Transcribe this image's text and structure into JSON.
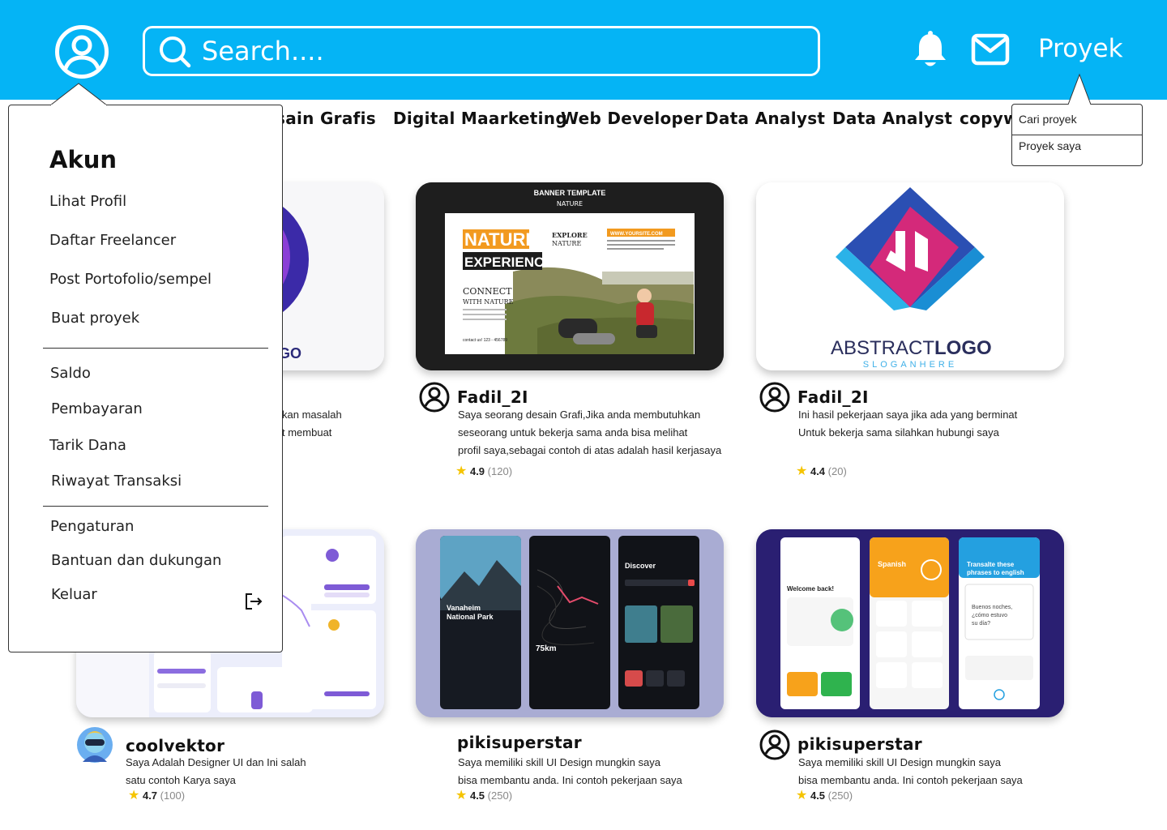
{
  "header": {
    "search_placeholder": "Search....",
    "proyek_label": "Proyek",
    "colors": {
      "header_bg": "#05b4f5",
      "header_text": "#ffffff"
    }
  },
  "categories": [
    "sain Grafis",
    "Digital Maarketing",
    "Web Developer",
    "Data Analyst",
    "Data Analyst",
    "copywr"
  ],
  "account_menu": {
    "title": "Akun",
    "group1": [
      "Lihat Profil",
      "Daftar Freelancer",
      "Post Portofolio/sempel",
      "Buat proyek"
    ],
    "group2": [
      "Saldo",
      "Pembayaran",
      "Tarik Dana",
      "Riwayat Transaksi"
    ],
    "group3": [
      "Pengaturan",
      "Bantuan  dan dukungan",
      "Keluar"
    ]
  },
  "proyek_menu": [
    "Cari proyek",
    "Proyek saya"
  ],
  "cards": [
    {
      "image": "logo design (partially hidden)",
      "image_text": "GO",
      "desc_visible": [
        "kan masalah",
        "t membuat"
      ]
    },
    {
      "image": "nature banner template",
      "image_texts": {
        "top_title": "BANNER TEMPLATE",
        "top_sub": "NATURE",
        "big1": "NATURE",
        "big2": "EXPERIENCE",
        "connect1": "CONNECT",
        "connect2": "WITH NATURE",
        "explore1": "EXPLORE",
        "explore2": "NATURE",
        "web": "WWW.YOURSITE.COM",
        "contact": "contact us! 123 - 456789"
      },
      "user": "Fadil_2I",
      "desc": [
        "Saya seorang desain Grafi,Jika anda membutuhkan",
        "seseorang untuk bekerja sama anda bisa melihat",
        "profil saya,sebagai contoh di atas adalah hasil kerjasaya"
      ],
      "rating": "4.9",
      "reviews": "(120)"
    },
    {
      "image": "abstract logo",
      "image_texts": {
        "logo1": "ABSTRACT",
        "logo2": "LOGO",
        "slogan": "SLOGANHERE"
      },
      "user": "Fadil_2I",
      "desc": [
        "Ini hasil pekerjaan saya jika ada yang  berminat",
        "Untuk bekerja sama silahkan hubungi saya"
      ],
      "rating": "4.4",
      "reviews": "(20)"
    },
    {
      "image": "dashboard ui",
      "user": "coolvektor",
      "desc": [
        "Saya Adalah Designer UI dan Ini salah",
        "satu contoh Karya saya"
      ],
      "rating": "4.7",
      "reviews": "(100)"
    },
    {
      "image": "travel app ui",
      "image_texts": {
        "park1": "Vanaheim",
        "park2": "National Park",
        "distance": "75km",
        "discover": "Discover"
      },
      "user": "pikisuperstar",
      "desc": [
        "Saya memiliki skill UI Design mungkin saya",
        "bisa membantu anda. Ini contoh pekerjaan saya"
      ],
      "rating": "4.5",
      "reviews": "(250)"
    },
    {
      "image": "language app ui",
      "image_texts": {
        "welcome": "Welcome back!",
        "spanish": "Spanish",
        "translate1": "Transalte these",
        "translate2": "phrases to english",
        "q1": "Buenos noches,",
        "q2": "¿cómo estuvo",
        "q3": "su día?"
      },
      "user": "pikisuperstar",
      "desc": [
        "Saya memiliki skill UI Design mungkin saya",
        "bisa membantu anda. Ini contoh pekerjaan saya"
      ],
      "rating": "4.5",
      "reviews": "(250)"
    }
  ]
}
